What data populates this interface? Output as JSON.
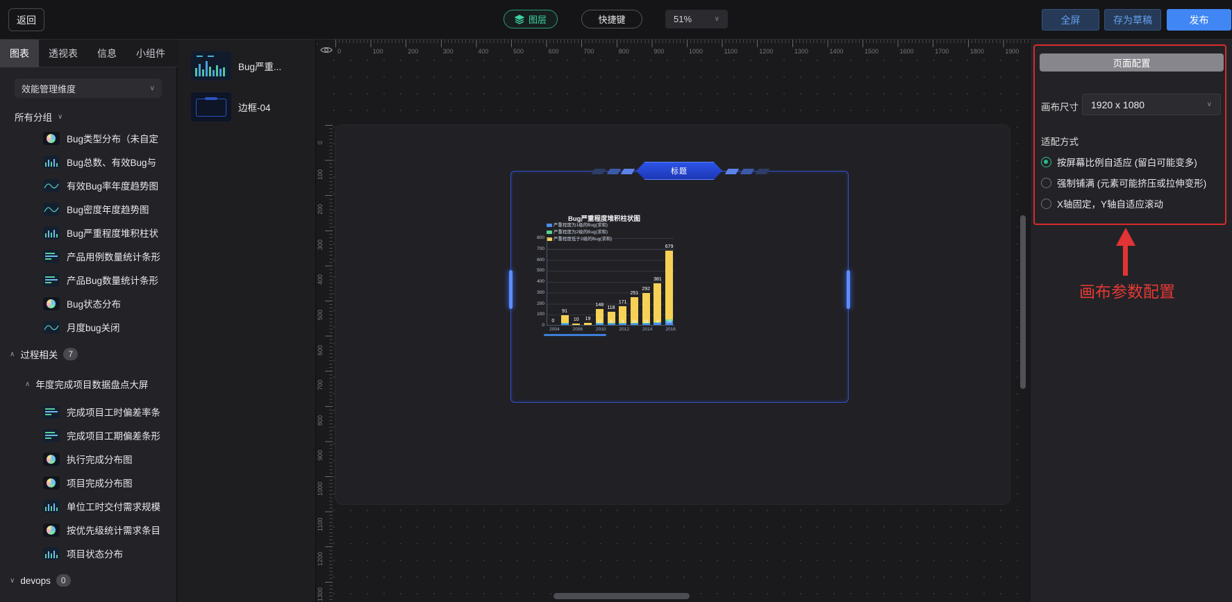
{
  "topbar": {
    "back": "返回",
    "layers": "图层",
    "shortcuts": "快捷键",
    "zoom_level": "51%",
    "fullscreen": "全屏",
    "save_draft": "存为草稿",
    "publish": "发布"
  },
  "sidebar": {
    "tabs": [
      {
        "label": "图表",
        "active": true
      },
      {
        "label": "透视表",
        "active": false
      },
      {
        "label": "信息",
        "active": false
      },
      {
        "label": "小组件",
        "active": false
      }
    ],
    "dimension_select": "效能管理维度",
    "all_groups_label": "所有分组",
    "items": [
      {
        "label": "Bug类型分布（未自定",
        "icon": "pie-chart"
      },
      {
        "label": "Bug总数、有效Bug与",
        "icon": "bar-chart"
      },
      {
        "label": "有效Bug率年度趋势图",
        "icon": "line-chart"
      },
      {
        "label": "Bug密度年度趋势图",
        "icon": "line-chart"
      },
      {
        "label": "Bug严重程度堆积柱状",
        "icon": "bar-chart"
      },
      {
        "label": "产品用例数量统计条形",
        "icon": "hbar-chart"
      },
      {
        "label": "产品Bug数量统计条形",
        "icon": "hbar-chart"
      },
      {
        "label": "Bug状态分布",
        "icon": "pie-chart"
      },
      {
        "label": "月度bug关闭",
        "icon": "line-chart"
      }
    ],
    "group": {
      "label": "过程相关",
      "count": "7"
    },
    "subgroup_label": "年度完成项目数据盘点大屏",
    "items2": [
      {
        "label": "完成项目工时偏差率条",
        "icon": "hbar-chart"
      },
      {
        "label": "完成项目工期偏差条形",
        "icon": "hbar-chart"
      },
      {
        "label": "执行完成分布图",
        "icon": "pie-chart"
      },
      {
        "label": "项目完成分布图",
        "icon": "pie-chart"
      },
      {
        "label": "单位工时交付需求规模",
        "icon": "bar-chart"
      },
      {
        "label": "按优先级统计需求条目",
        "icon": "pie-chart"
      },
      {
        "label": "项目状态分布",
        "icon": "bar-chart"
      }
    ],
    "devops_group": {
      "label": "devops",
      "count": "0"
    }
  },
  "assets_panel": {
    "items": [
      {
        "label": "Bug严重..."
      },
      {
        "label": "边框-04"
      }
    ]
  },
  "canvas": {
    "h_ruler_labels": [
      "0",
      "100",
      "200",
      "300",
      "400",
      "500",
      "600",
      "700",
      "800",
      "900",
      "1000",
      "1100",
      "1200",
      "1300",
      "1400",
      "1500",
      "1600",
      "1700",
      "1800",
      "1900"
    ],
    "v_ruler_labels": [
      "0",
      "100",
      "200",
      "300",
      "400",
      "500",
      "600",
      "700",
      "800",
      "900",
      "1000",
      "1100",
      "1200",
      "1300"
    ],
    "widget_badge": "标题"
  },
  "right_panel": {
    "title": "页面配置",
    "canvas_size_label": "画布尺寸",
    "canvas_size_value": "1920 x 1080",
    "fit_mode_label": "适配方式",
    "fit_options": [
      {
        "label": "按屏幕比例自适应 (留白可能变多)",
        "selected": true
      },
      {
        "label": "强制铺满 (元素可能挤压或拉伸变形)",
        "selected": false
      },
      {
        "label": "X轴固定，Y轴自适应滚动",
        "selected": false
      }
    ],
    "annotation_text": "画布参数配置",
    "annotation_color": "#e53935",
    "accent_green": "#2ebd85",
    "accent_blue": "#4086f4"
  },
  "chart_data": {
    "type": "bar",
    "stacked": true,
    "title": "Bug严重程度堆积柱状图",
    "series": [
      {
        "name": "严重程度为1级的Bug(求和)",
        "color": "#4b8df0"
      },
      {
        "name": "严重程度为2级的Bug(求和)",
        "color": "#56d394"
      },
      {
        "name": "严重程度低于2级的Bug(求和)",
        "color": "#f6d155"
      }
    ],
    "x_tick_labels": [
      "2004",
      "2006",
      "2010",
      "2012",
      "2014",
      "2016"
    ],
    "ylim": [
      0,
      800
    ],
    "y_ticks": [
      0,
      100,
      200,
      300,
      400,
      500,
      600,
      700,
      800
    ],
    "bar_totals": [
      0,
      91,
      10,
      19,
      148,
      118,
      171,
      251,
      292,
      381,
      679
    ],
    "bar_inner_labels": [
      null,
      "8",
      null,
      null,
      "12",
      "8",
      "9",
      "14",
      "18",
      "9",
      "29"
    ],
    "legend_position": "top",
    "grid": true
  }
}
